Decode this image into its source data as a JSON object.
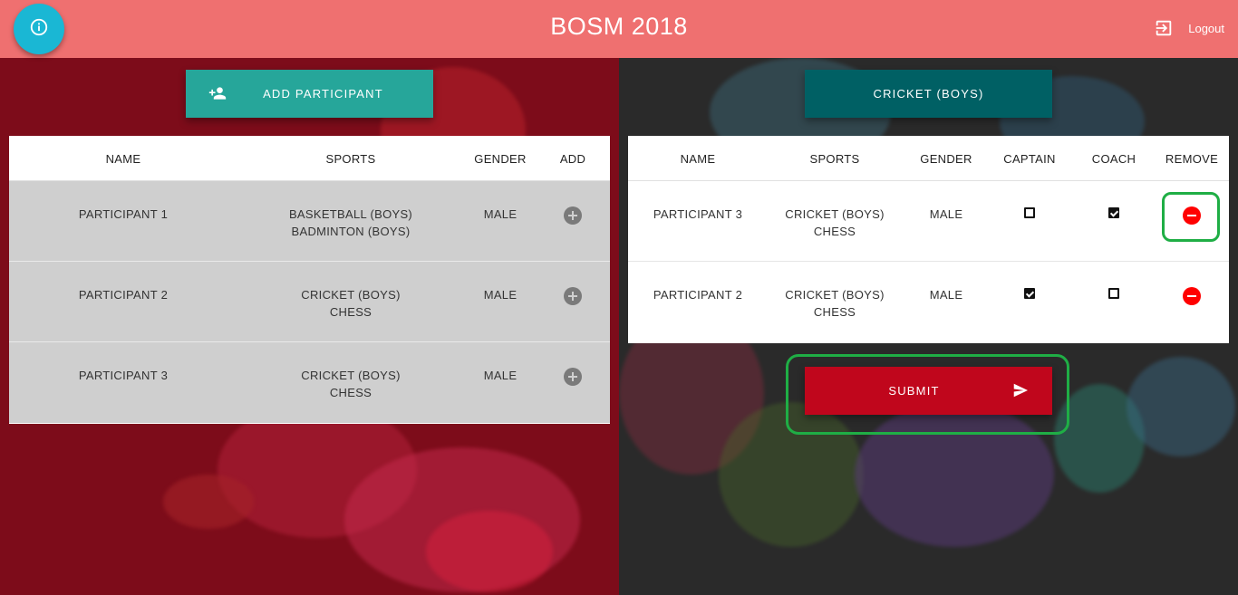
{
  "header": {
    "title": "BOSM 2018",
    "logout_label": "Logout"
  },
  "left": {
    "add_button_label": "ADD PARTICIPANT",
    "columns": [
      "NAME",
      "SPORTS",
      "GENDER",
      "ADD"
    ],
    "rows": [
      {
        "name": "PARTICIPANT 1",
        "sport1": "BASKETBALL (BOYS)",
        "sport2": "BADMINTON (BOYS)",
        "gender": "MALE"
      },
      {
        "name": "PARTICIPANT 2",
        "sport1": "CRICKET (BOYS)",
        "sport2": "CHESS",
        "gender": "MALE"
      },
      {
        "name": "PARTICIPANT 3",
        "sport1": "CRICKET (BOYS)",
        "sport2": "CHESS",
        "gender": "MALE"
      }
    ]
  },
  "right": {
    "sport_button_label": "CRICKET (BOYS)",
    "columns": [
      "NAME",
      "SPORTS",
      "GENDER",
      "CAPTAIN",
      "COACH",
      "REMOVE"
    ],
    "rows": [
      {
        "name": "PARTICIPANT 3",
        "sport1": "CRICKET (BOYS)",
        "sport2": "CHESS",
        "gender": "MALE",
        "captain": false,
        "coach": true
      },
      {
        "name": "PARTICIPANT 2",
        "sport1": "CRICKET (BOYS)",
        "sport2": "CHESS",
        "gender": "MALE",
        "captain": true,
        "coach": false
      }
    ],
    "submit_label": "SUBMIT"
  },
  "colors": {
    "header": "#ef7070",
    "fab": "#1ab7d4",
    "add_button": "#26a69a",
    "sport_button": "#006064",
    "submit_button": "#c0061c",
    "remove_icon": "#ff0000",
    "highlight": "#1fae45"
  },
  "icons": {
    "fab": "info-icon",
    "logout": "logout-icon",
    "add_button": "person-add-icon",
    "submit": "send-icon",
    "row_add": "add-circle-icon",
    "row_remove": "remove-circle-icon"
  }
}
